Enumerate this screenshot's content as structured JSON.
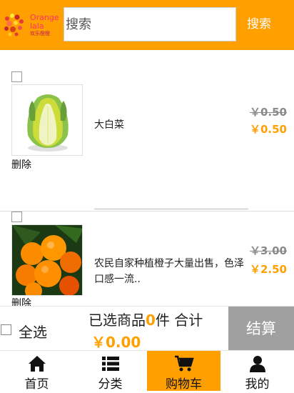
{
  "header": {
    "logo_lines": [
      "Orange",
      "lala",
      "欢乐橙橙"
    ],
    "search_placeholder": "搜索",
    "search_button_label": "搜索",
    "accent_color": "#ff9f00"
  },
  "cart_items": [
    {
      "name": "大白菜",
      "original_price": "￥0.50",
      "price": "￥0.50",
      "delete_label": "删除",
      "image": "napa-cabbage",
      "checked": false
    },
    {
      "name": "农民自家种植橙子大量出售，色泽口感一流..",
      "original_price": "￥3.00",
      "price": "￥2.50",
      "delete_label": "删除",
      "image": "oranges",
      "checked": false
    }
  ],
  "summary": {
    "select_all_label": "全选",
    "selected_prefix": "已选商品",
    "selected_count": "0",
    "selected_suffix": "件 合计",
    "total": "￥0.00",
    "checkout_label": "结算",
    "checkout_color": "#a0a0a0"
  },
  "bottom_nav": {
    "items": [
      {
        "label": "首页",
        "icon": "home-icon",
        "active": false
      },
      {
        "label": "分类",
        "icon": "list-icon",
        "active": false
      },
      {
        "label": "购物车",
        "icon": "cart-icon",
        "active": true
      },
      {
        "label": "我的",
        "icon": "user-icon",
        "active": false
      }
    ]
  }
}
